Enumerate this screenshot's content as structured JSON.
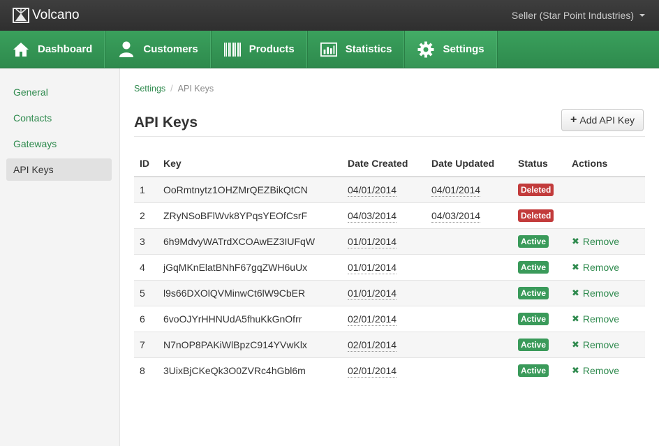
{
  "app": {
    "brand": "Volcano",
    "account_label": "Seller (Star Point Industries)"
  },
  "nav": {
    "items": [
      {
        "label": "Dashboard",
        "icon": "home-icon"
      },
      {
        "label": "Customers",
        "icon": "user-icon"
      },
      {
        "label": "Products",
        "icon": "barcode-icon"
      },
      {
        "label": "Statistics",
        "icon": "bar-chart-icon"
      },
      {
        "label": "Settings",
        "icon": "gear-icon",
        "active": true
      }
    ]
  },
  "sidebar": {
    "items": [
      {
        "label": "General"
      },
      {
        "label": "Contacts"
      },
      {
        "label": "Gateways"
      },
      {
        "label": "API Keys",
        "active": true
      }
    ]
  },
  "breadcrumb": {
    "root": "Settings",
    "separator": "/",
    "current": "API Keys"
  },
  "page": {
    "title": "API Keys",
    "add_button_label": "Add API Key"
  },
  "table": {
    "headers": {
      "id": "ID",
      "key": "Key",
      "created": "Date Created",
      "updated": "Date Updated",
      "status": "Status",
      "actions": "Actions"
    },
    "rows": [
      {
        "id": "1",
        "key": "OoRmtnytz1OHZMrQEZBikQtCN",
        "created": "04/01/2014",
        "updated": "04/01/2014",
        "status": "Deleted",
        "action": ""
      },
      {
        "id": "2",
        "key": "ZRyNSoBFlWvk8YPqsYEOfCsrF",
        "created": "04/03/2014",
        "updated": "04/03/2014",
        "status": "Deleted",
        "action": ""
      },
      {
        "id": "3",
        "key": "6h9MdvyWATrdXCOAwEZ3IUFqW",
        "created": "01/01/2014",
        "updated": "",
        "status": "Active",
        "action": "Remove"
      },
      {
        "id": "4",
        "key": "jGqMKnElatBNhF67gqZWH6uUx",
        "created": "01/01/2014",
        "updated": "",
        "status": "Active",
        "action": "Remove"
      },
      {
        "id": "5",
        "key": "l9s66DXOlQVMinwCt6lW9CbER",
        "created": "01/01/2014",
        "updated": "",
        "status": "Active",
        "action": "Remove"
      },
      {
        "id": "6",
        "key": "6voOJYrHHNUdA5fhuKkGnOfrr",
        "created": "02/01/2014",
        "updated": "",
        "status": "Active",
        "action": "Remove"
      },
      {
        "id": "7",
        "key": "N7nOP8PAKiWlBpzC914YVwKlx",
        "created": "02/01/2014",
        "updated": "",
        "status": "Active",
        "action": "Remove"
      },
      {
        "id": "8",
        "key": "3UixBjCKeQk3O0ZVRc4hGbl6m",
        "created": "02/01/2014",
        "updated": "",
        "status": "Active",
        "action": "Remove"
      }
    ]
  },
  "colors": {
    "brand_green": "#3aa05c",
    "link_green": "#2f8a4e",
    "deleted_red": "#c23b3b",
    "active_green": "#3a9a5a",
    "topbar": "#333333"
  }
}
